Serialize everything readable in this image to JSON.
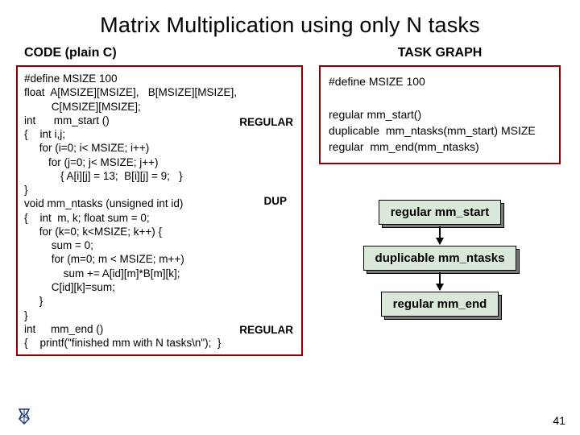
{
  "title": "Matrix Multiplication using only N tasks",
  "left_label": "CODE (plain C)",
  "right_label": "TASK GRAPH",
  "code_text": "#define MSIZE 100\nfloat  A[MSIZE][MSIZE],   B[MSIZE][MSIZE],\n         C[MSIZE][MSIZE];\nint      mm_start ()\n{    int i,j;\n     for (i=0; i< MSIZE; i++)\n        for (j=0; j< MSIZE; j++)\n            { A[i][j] = 13;  B[i][j] = 9;   }\n}\nvoid mm_ntasks (unsigned int id)\n{    int  m, k; float sum = 0;\n     for (k=0; k<MSIZE; k++) {\n         sum = 0;\n         for (m=0; m < MSIZE; m++)\n             sum += A[id][m]*B[m][k];\n         C[id][k]=sum;\n     }\n}\nint     mm_end ()\n{    printf(\"finished mm with N tasks\\n\");  }",
  "tag_regular": "REGULAR",
  "tag_dup": "DUP",
  "task_text": "#define MSIZE 100\n\nregular mm_start()\nduplicable  mm_ntasks(mm_start) MSIZE\nregular  mm_end(mm_ntasks)",
  "graph": {
    "node1": "regular mm_start",
    "node2": "duplicable mm_ntasks",
    "node3": "regular mm_end"
  },
  "page": "41"
}
